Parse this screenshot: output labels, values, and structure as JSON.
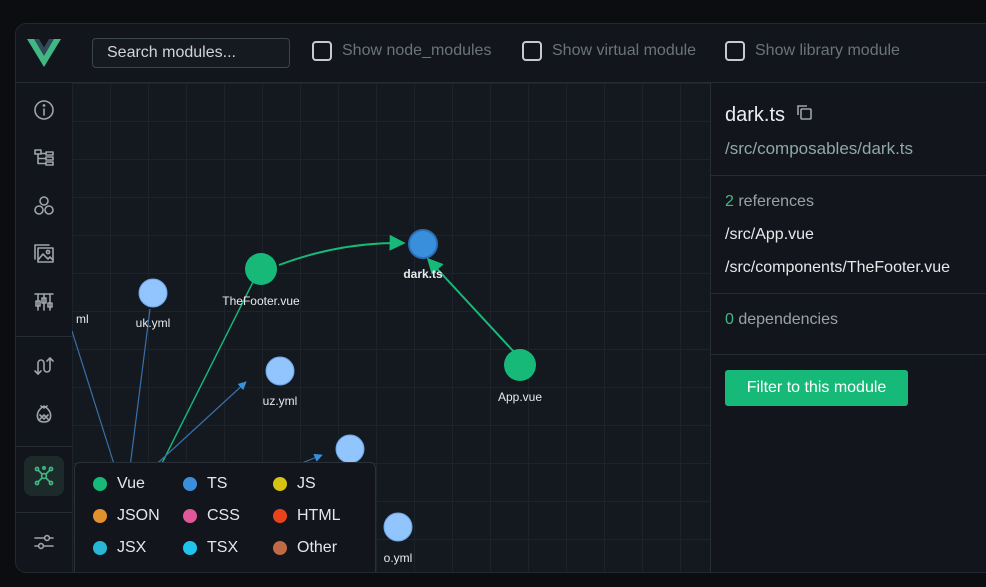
{
  "toolbar": {
    "search_placeholder": "Search modules...",
    "checkboxes": [
      {
        "label": "Show node_modules",
        "checked": false
      },
      {
        "label": "Show virtual module",
        "checked": false
      },
      {
        "label": "Show library module",
        "checked": false
      }
    ]
  },
  "sidebar": {
    "items": [
      {
        "icon": "info-icon"
      },
      {
        "icon": "tree-icon"
      },
      {
        "icon": "components-icon"
      },
      {
        "icon": "assets-icon"
      },
      {
        "icon": "timeline-icon"
      },
      {
        "icon": "routes-icon"
      },
      {
        "icon": "pinia-icon"
      },
      {
        "icon": "graph-icon",
        "active": true
      },
      {
        "icon": "settings-icon"
      }
    ]
  },
  "graph": {
    "nodes": [
      {
        "id": "dark",
        "label": "dark.ts",
        "type": "TS",
        "selected": true
      },
      {
        "id": "footer",
        "label": "TheFooter.vue",
        "type": "Vue"
      },
      {
        "id": "app",
        "label": "App.vue",
        "type": "Vue"
      },
      {
        "id": "uk",
        "label": "uk.yml",
        "type": "Other"
      },
      {
        "id": "uz",
        "label": "uz.yml",
        "type": "Other"
      },
      {
        "id": "partial_left",
        "label": "ml",
        "type": "Other"
      },
      {
        "id": "partial_bottom",
        "label": "o.yml",
        "type": "Other"
      },
      {
        "id": "unlabeled",
        "label": "",
        "type": "Other"
      }
    ]
  },
  "legend": [
    {
      "label": "Vue",
      "color": "#17b978"
    },
    {
      "label": "TS",
      "color": "#3a8fdc"
    },
    {
      "label": "JS",
      "color": "#d4c411"
    },
    {
      "label": "JSON",
      "color": "#e2912d"
    },
    {
      "label": "CSS",
      "color": "#e2569a"
    },
    {
      "label": "HTML",
      "color": "#e8441c"
    },
    {
      "label": "JSX",
      "color": "#26b8d6"
    },
    {
      "label": "TSX",
      "color": "#1fc4ee"
    },
    {
      "label": "Other",
      "color": "#c06a45"
    }
  ],
  "panel": {
    "file_name": "dark.ts",
    "file_path": "/src/composables/dark.ts",
    "references_count": "2",
    "references_word": " references",
    "references": [
      "/src/App.vue",
      "/src/components/TheFooter.vue"
    ],
    "dependencies_count": "0",
    "dependencies_word": " dependencies",
    "filter_button": "Filter to this module"
  },
  "colors": {
    "accent": "#41b883",
    "selected_node": "#3a8fdc",
    "other_node": "#92c5fd"
  }
}
